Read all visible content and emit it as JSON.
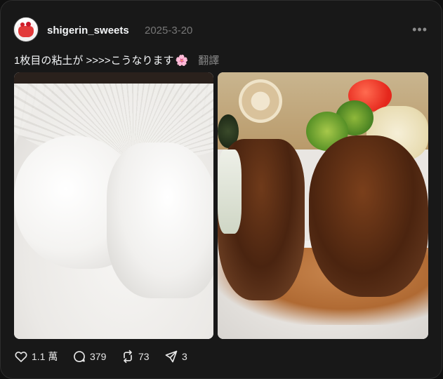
{
  "post": {
    "username": "shigerin_sweets",
    "date": "2025-3-20",
    "more_icon": "•••",
    "caption": "1枚目の粘土が >>>>こうなります",
    "caption_emoji": "🌸",
    "translate_label": "翻譯"
  },
  "images": [
    {
      "name": "clay-photo"
    },
    {
      "name": "hamburg-steak-photo"
    }
  ],
  "actions": {
    "likes": "1.1 萬",
    "comments": "379",
    "reposts": "73",
    "shares": "3"
  },
  "colors": {
    "background": "#101010",
    "card": "#181818",
    "text": "#f3f5f7",
    "muted": "#777777",
    "accent_pink": "#ff6fa8"
  }
}
